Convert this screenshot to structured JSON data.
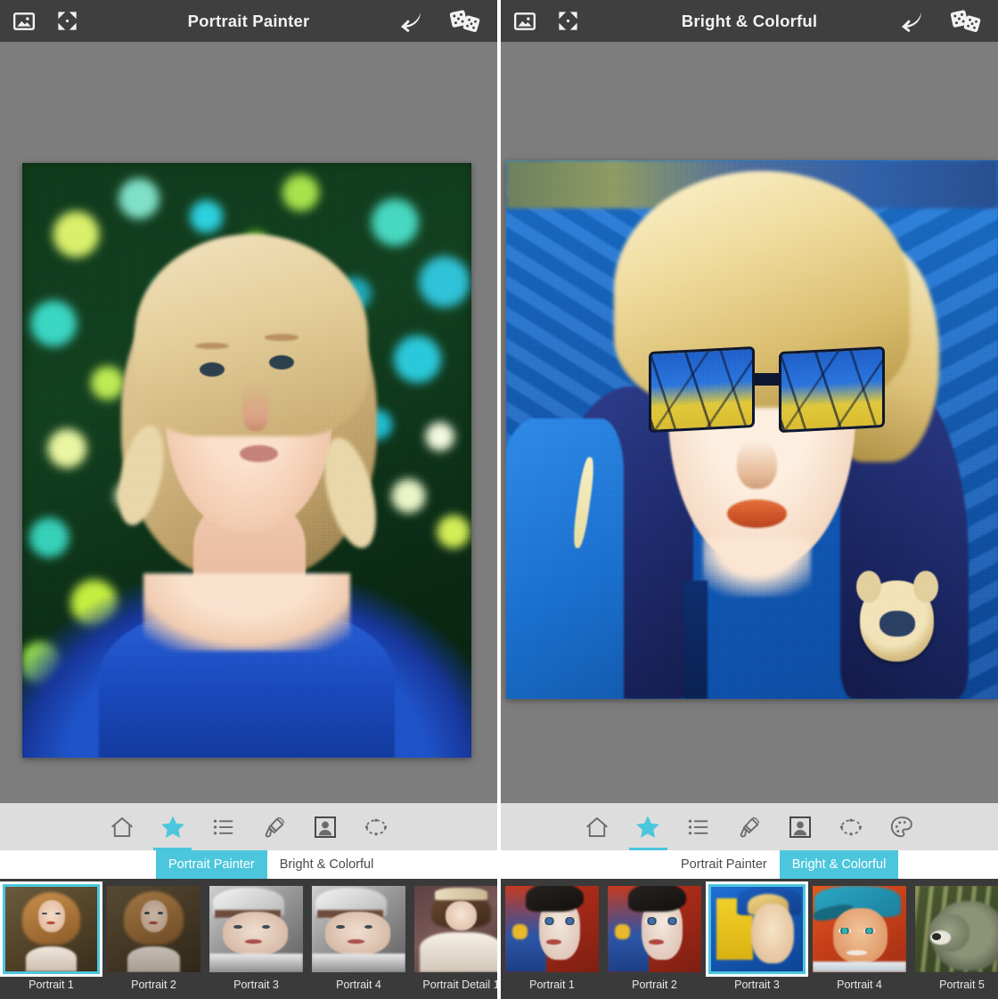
{
  "app": {
    "accent_color": "#4cc6dd",
    "header_bg": "#3f3f3f",
    "stage_bg": "#7d7d7d",
    "toolbar_bg": "#dddddd",
    "strip_bg": "#3a3a3a"
  },
  "panels": [
    {
      "id": "left",
      "header": {
        "title": "Portrait Painter",
        "left_icons": [
          {
            "name": "photo-icon",
            "label": "Photo"
          },
          {
            "name": "fullscreen-icon",
            "label": "Fullscreen"
          }
        ],
        "right_icons": [
          {
            "name": "undo-icon",
            "label": "Undo"
          },
          {
            "name": "dice-icon",
            "label": "Randomize"
          }
        ]
      },
      "artwork": {
        "alt": "Painted portrait of a blonde woman in a blue top against green bokeh foliage"
      },
      "toolbar": [
        {
          "name": "home-icon",
          "label": "Home",
          "active": false
        },
        {
          "name": "star-icon",
          "label": "Favorites",
          "active": true
        },
        {
          "name": "list-icon",
          "label": "Presets",
          "active": false
        },
        {
          "name": "paintbrush-icon",
          "label": "Brush",
          "active": false
        },
        {
          "name": "portrait-icon",
          "label": "Portrait",
          "active": false
        },
        {
          "name": "oval-selection-icon",
          "label": "Selection",
          "active": false
        }
      ],
      "tabs": [
        {
          "label": "Portrait Painter",
          "selected": true
        },
        {
          "label": "Bright & Colorful",
          "selected": false
        }
      ],
      "thumbnails": [
        {
          "label": "Portrait 1",
          "selected": true,
          "art": "woman"
        },
        {
          "label": "Portrait 2",
          "selected": false,
          "art": "woman-dark"
        },
        {
          "label": "Portrait 3",
          "selected": false,
          "art": "bw-hat"
        },
        {
          "label": "Portrait 4",
          "selected": false,
          "art": "bw-hat"
        },
        {
          "label": "Portrait Detail 1",
          "selected": false,
          "art": "victorian"
        }
      ]
    },
    {
      "id": "right",
      "header": {
        "title": "Bright & Colorful",
        "left_icons": [
          {
            "name": "photo-icon",
            "label": "Photo"
          },
          {
            "name": "fullscreen-icon",
            "label": "Fullscreen"
          }
        ],
        "right_icons": [
          {
            "name": "undo-icon",
            "label": "Undo"
          },
          {
            "name": "dice-icon",
            "label": "Randomize"
          }
        ]
      },
      "artwork": {
        "alt": "Painted portrait of a blonde child in blue sunglasses and a blue hooded jacket"
      },
      "toolbar": [
        {
          "name": "home-icon",
          "label": "Home",
          "active": false
        },
        {
          "name": "star-icon",
          "label": "Favorites",
          "active": true
        },
        {
          "name": "list-icon",
          "label": "Presets",
          "active": false
        },
        {
          "name": "paintbrush-icon",
          "label": "Brush",
          "active": false
        },
        {
          "name": "portrait-icon",
          "label": "Portrait",
          "active": false
        },
        {
          "name": "oval-selection-icon",
          "label": "Selection",
          "active": false
        },
        {
          "name": "palette-icon",
          "label": "Palette",
          "active": false
        }
      ],
      "tabs": [
        {
          "label": "Portrait Painter",
          "selected": false
        },
        {
          "label": "Bright & Colorful",
          "selected": true
        }
      ],
      "thumbnails": [
        {
          "label": "Portrait 1",
          "selected": false,
          "art": "goth"
        },
        {
          "label": "Portrait 2",
          "selected": false,
          "art": "goth"
        },
        {
          "label": "Portrait 3",
          "selected": true,
          "art": "blue-boy"
        },
        {
          "label": "Portrait 4",
          "selected": false,
          "art": "cap-boy"
        },
        {
          "label": "Portrait 5",
          "selected": false,
          "art": "koala"
        }
      ]
    }
  ]
}
